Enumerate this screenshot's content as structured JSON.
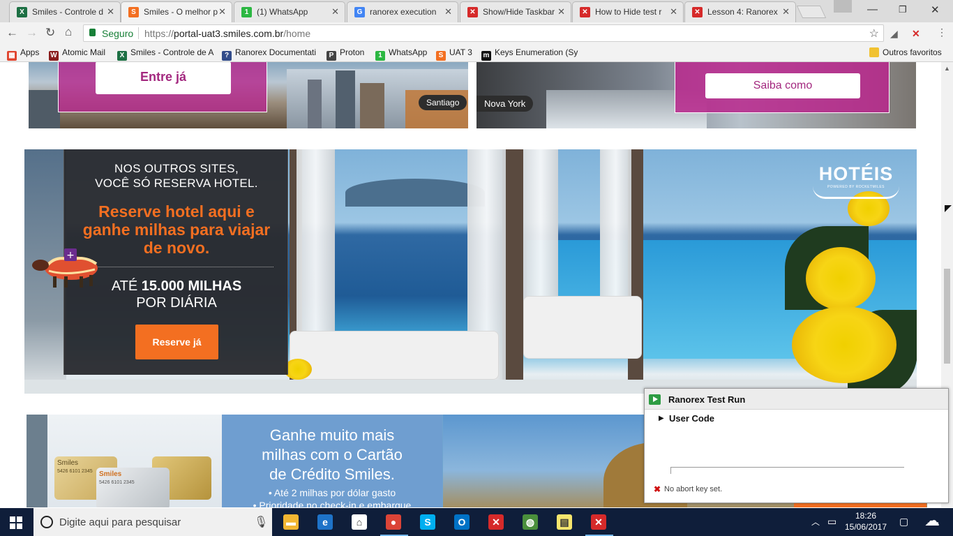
{
  "tabs": [
    {
      "title": "Smiles - Controle d",
      "icon": "excel-icon",
      "color": "#1d7044",
      "glyph": "X"
    },
    {
      "title": "Smiles - O melhor p",
      "icon": "smiles-icon",
      "color": "#f36f21",
      "glyph": "S",
      "active": true
    },
    {
      "title": "(1) WhatsApp",
      "icon": "whatsapp-icon",
      "color": "#2cb742",
      "glyph": "1"
    },
    {
      "title": "ranorex execution",
      "icon": "google-icon",
      "color": "#4285f4",
      "glyph": "G"
    },
    {
      "title": "Show/Hide Taskbar",
      "icon": "ranorex-icon",
      "color": "#d62a2a",
      "glyph": "✕"
    },
    {
      "title": "How to Hide test r",
      "icon": "ranorex-icon",
      "color": "#d62a2a",
      "glyph": "✕"
    },
    {
      "title": "Lesson 4: Ranorex",
      "icon": "ranorex-icon",
      "color": "#d62a2a",
      "glyph": "✕"
    }
  ],
  "toolbar": {
    "secure_label": "Seguro",
    "url_prefix": "https://",
    "url_host": "portal-uat3.smiles.com.br",
    "url_path": "/home"
  },
  "bookmarks": [
    {
      "label": "Apps",
      "icon": "apps-icon",
      "color": "#e0452f",
      "glyph": "▦"
    },
    {
      "label": "Atomic Mail",
      "icon": "atomic-mail-icon",
      "color": "#8a1c1c",
      "glyph": "W"
    },
    {
      "label": "Smiles - Controle de A",
      "icon": "excel-icon",
      "color": "#1d7044",
      "glyph": "X"
    },
    {
      "label": "Ranorex Documentati",
      "icon": "ranorex-doc-icon",
      "color": "#324c8a",
      "glyph": "?"
    },
    {
      "label": "Proton",
      "icon": "proton-icon",
      "color": "#444444",
      "glyph": "P"
    },
    {
      "label": "WhatsApp",
      "icon": "whatsapp-icon",
      "color": "#2cb742",
      "glyph": "1"
    },
    {
      "label": "UAT 3",
      "icon": "smiles-icon",
      "color": "#f36f21",
      "glyph": "S"
    },
    {
      "label": "Keys Enumeration (Sy",
      "icon": "msdn-icon",
      "color": "#111111",
      "glyph": "m"
    }
  ],
  "other_bookmarks": "Outros favoritos",
  "page": {
    "santiago": {
      "button": "Entre já",
      "city": "Santiago"
    },
    "newyork": {
      "button": "Saiba como",
      "city": "Nova York"
    },
    "hotel": {
      "line1": "NOS OUTROS SITES,",
      "line2": "VOCÊ SÓ RESERVA HOTEL.",
      "orange1": "Reserve hotel aqui e",
      "orange2": "ganhe milhas para viajar",
      "orange3": "de novo.",
      "ate": "ATÉ",
      "miles": "15.000 MILHAS",
      "por_diaria": "POR DIÁRIA",
      "button": "Reserve já",
      "logo": "HOTÉIS",
      "logo_sub": "POWERED BY ROCKETMILES"
    },
    "card": {
      "line1": "Ganhe muito mais",
      "line2": "milhas com o Cartão",
      "line3": "de Crédito Smiles.",
      "bullet1": "•  Até 2 milhas por dólar gasto",
      "bullet2": "•  Prioridade no check-in e embarque",
      "card_brand": "Smiles",
      "card_number": "5426 6101 2345",
      "card_number2": "5426 6101 2345"
    }
  },
  "ranorex": {
    "title": "Ranorex Test Run",
    "item": "User Code",
    "status": "No abort key set."
  },
  "taskbar": {
    "search_placeholder": "Digite aqui para pesquisar",
    "time": "18:26",
    "date": "15/06/2017",
    "apps": [
      {
        "name": "file-explorer-icon",
        "color": "#f2b632",
        "glyph": "▬"
      },
      {
        "name": "edge-icon",
        "color": "#1e73c8",
        "glyph": "e"
      },
      {
        "name": "store-icon",
        "color": "#ffffff",
        "glyph": "⌂"
      },
      {
        "name": "chrome-icon",
        "color": "#db4437",
        "glyph": "●",
        "active": true
      },
      {
        "name": "skype-icon",
        "color": "#00aff0",
        "glyph": "S"
      },
      {
        "name": "outlook-icon",
        "color": "#0072c6",
        "glyph": "O"
      },
      {
        "name": "ranorex-studio-icon",
        "color": "#d62a2a",
        "glyph": "✕"
      },
      {
        "name": "globe-icon",
        "color": "#4a8f3c",
        "glyph": "◍"
      },
      {
        "name": "sticky-notes-icon",
        "color": "#f7e66d",
        "glyph": "▤"
      },
      {
        "name": "ranorex-run-icon",
        "color": "#d62a2a",
        "glyph": "✕",
        "active": true
      }
    ]
  }
}
